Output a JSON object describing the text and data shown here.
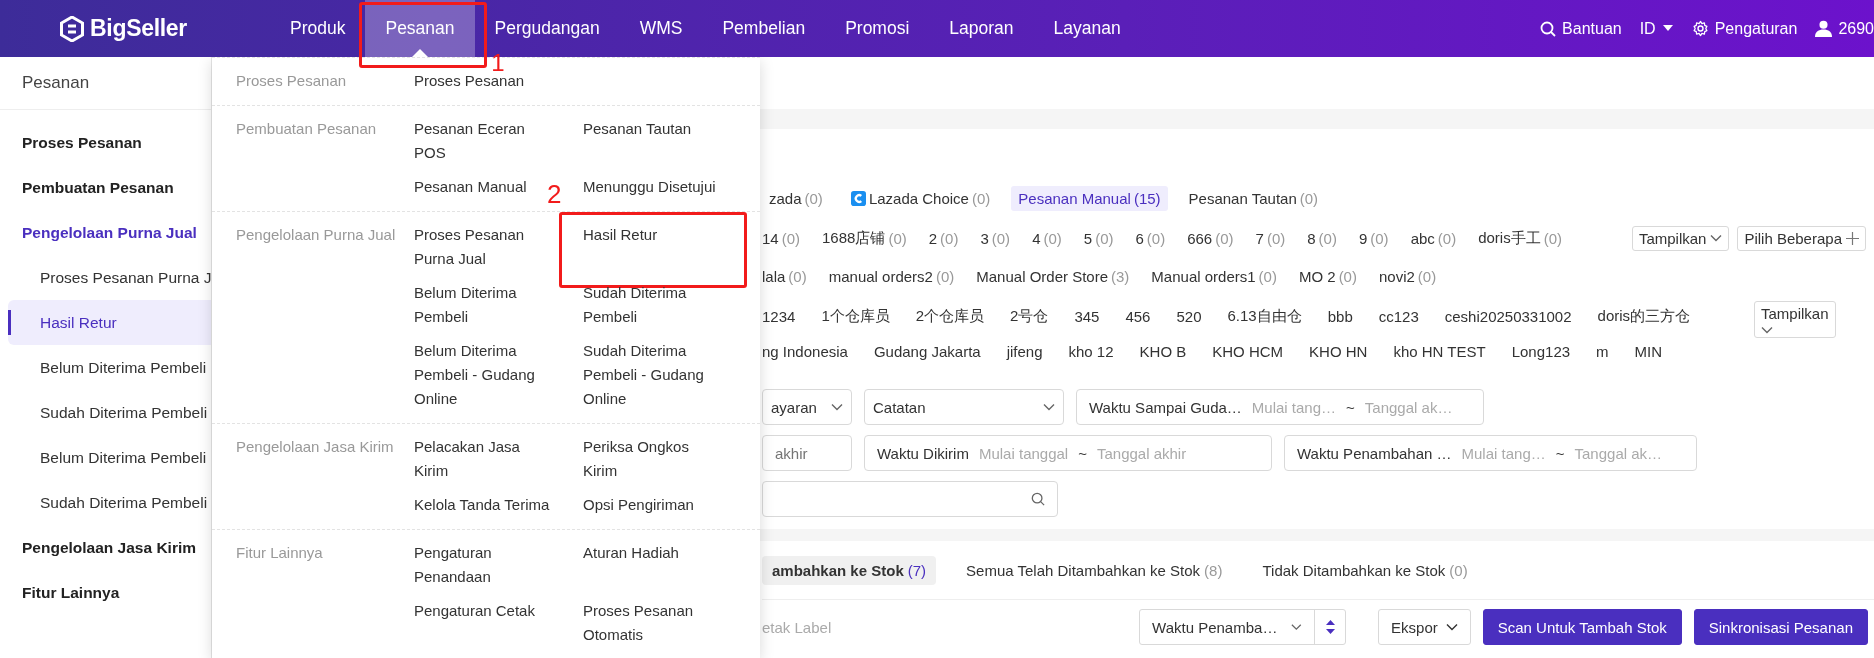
{
  "topbar": {
    "logo": "BigSeller",
    "nav": [
      {
        "label": "Produk",
        "selected": false
      },
      {
        "label": "Pesanan",
        "selected": true,
        "annotation": "1"
      },
      {
        "label": "Pergudangan",
        "selected": false
      },
      {
        "label": "WMS",
        "selected": false
      },
      {
        "label": "Pembelian",
        "selected": false
      },
      {
        "label": "Promosi",
        "selected": false
      },
      {
        "label": "Laporan",
        "selected": false
      },
      {
        "label": "Layanan",
        "selected": false
      }
    ],
    "help": "Bantuan",
    "language": "ID",
    "settings": "Pengaturan",
    "user": "2690"
  },
  "sidebar": {
    "title": "Pesanan",
    "items": [
      {
        "label": "Proses Pesanan",
        "selected": false
      },
      {
        "label": "Pembuatan Pesanan",
        "selected": false
      },
      {
        "label": "Pengelolaan Purna Jual",
        "selected": true,
        "children": [
          {
            "label": "Proses Pesanan Purna J",
            "selected": false
          },
          {
            "label": "Hasil Retur",
            "selected": true
          },
          {
            "label": "Belum Diterima Pembeli",
            "selected": false
          },
          {
            "label": "Sudah Diterima Pembeli",
            "selected": false
          },
          {
            "label": "Belum Diterima Pembeli",
            "selected": false
          },
          {
            "label": "Sudah Diterima Pembeli",
            "selected": false
          }
        ]
      },
      {
        "label": "Pengelolaan Jasa Kirim",
        "selected": false
      },
      {
        "label": "Fitur Lainnya",
        "selected": false
      }
    ]
  },
  "menu": {
    "sections": [
      {
        "title": "Proses Pesanan",
        "links": [
          {
            "label": "Proses Pesanan"
          }
        ]
      },
      {
        "title": "Pembuatan Pesanan",
        "links": [
          {
            "label": "Pesanan Eceran POS"
          },
          {
            "label": "Pesanan Tautan"
          },
          {
            "label": "Pesanan Manual"
          },
          {
            "label": "Menunggu Disetujui"
          }
        ]
      },
      {
        "title": "Pengelolaan Purna Jual",
        "links": [
          {
            "label": "Proses Pesanan Purna Jual"
          },
          {
            "label": "Hasil Retur",
            "annotation": "2"
          },
          {
            "label": "Belum Diterima Pembeli"
          },
          {
            "label": "Sudah Diterima Pembeli"
          },
          {
            "label": "Belum Diterima Pembeli - Gudang Online"
          },
          {
            "label": "Sudah Diterima Pembeli - Gudang Online"
          }
        ]
      },
      {
        "title": "Pengelolaan Jasa Kirim",
        "links": [
          {
            "label": "Pelacakan Jasa Kirim"
          },
          {
            "label": "Periksa Ongkos Kirim"
          },
          {
            "label": "Kelola Tanda Terima"
          },
          {
            "label": "Opsi Pengiriman"
          }
        ]
      },
      {
        "title": "Fitur Lainnya",
        "links": [
          {
            "label": "Pengaturan Penandaan"
          },
          {
            "label": "Aturan Hadiah"
          },
          {
            "label": "Pengaturan Cetak"
          },
          {
            "label": "Proses Pesanan Otomatis"
          }
        ]
      }
    ]
  },
  "filters": {
    "platforms": [
      {
        "label": "zada",
        "count": "(0)",
        "selected": false,
        "icon": false
      },
      {
        "label": "Lazada Choice",
        "count": "(0)",
        "selected": false,
        "icon": true
      },
      {
        "label": "Pesanan Manual",
        "count": "(15)",
        "selected": true,
        "icon": false
      },
      {
        "label": "Pesanan Tautan",
        "count": "(0)",
        "selected": false,
        "icon": false
      }
    ],
    "store_rows": [
      [
        {
          "label": "14",
          "count": "(0)"
        },
        {
          "label": "1688店铺",
          "count": "(0)"
        },
        {
          "label": "2",
          "count": "(0)"
        },
        {
          "label": "3",
          "count": "(0)"
        },
        {
          "label": "4",
          "count": "(0)"
        },
        {
          "label": "5",
          "count": "(0)"
        },
        {
          "label": "6",
          "count": "(0)"
        },
        {
          "label": "666",
          "count": "(0)"
        },
        {
          "label": "7",
          "count": "(0)"
        },
        {
          "label": "8",
          "count": "(0)"
        },
        {
          "label": "9",
          "count": "(0)"
        },
        {
          "label": "abc",
          "count": "(0)"
        },
        {
          "label": "doris手工",
          "count": "(0)"
        }
      ],
      [
        {
          "label": "lala",
          "count": "(0)"
        },
        {
          "label": "manual orders2",
          "count": "(0)"
        },
        {
          "label": "Manual Order Store",
          "count": "(3)"
        },
        {
          "label": "Manual orders1",
          "count": "(0)"
        },
        {
          "label": "MO 2",
          "count": "(0)"
        },
        {
          "label": "novi2",
          "count": "(0)"
        }
      ]
    ],
    "store_show": "Tampilkan",
    "store_multi": "Pilih Beberapa",
    "warehouse_rows": [
      [
        "1234",
        "1个仓库员",
        "2个仓库员",
        "2号仓",
        "345",
        "456",
        "520",
        "6.13自由仓",
        "bbb",
        "cc123",
        "ceshi20250331002",
        "doris的三方仓"
      ],
      [
        "ng Indonesia",
        "Gudang Jakarta",
        "jifeng",
        "kho 12",
        "KHO B",
        "KHO HCM",
        "KHO HN",
        "kho HN TEST",
        "Long123",
        "m",
        "MIN"
      ]
    ],
    "warehouse_show": "Tampilkan",
    "fields": [
      [
        {
          "kind": "select",
          "value": "ayaran"
        },
        {
          "kind": "select",
          "value": "Catatan"
        },
        {
          "kind": "date_range",
          "label": "Waktu Sampai Guda…",
          "start": "Mulai tang…",
          "separator": "~",
          "end": "Tanggal ak…"
        }
      ],
      [
        {
          "kind": "text",
          "placeholder": "akhir"
        },
        {
          "kind": "date_range",
          "label": "Waktu Dikirim",
          "start": "Mulai tanggal",
          "separator": "~",
          "end": "Tanggal akhir"
        },
        {
          "kind": "date_range",
          "label": "Waktu Penambahan …",
          "start": "Mulai tang…",
          "separator": "~",
          "end": "Tanggal ak…"
        }
      ],
      [
        {
          "kind": "search"
        }
      ]
    ]
  },
  "stock": {
    "tabs": [
      {
        "label": "ambahkan ke Stok",
        "count": "(7)",
        "selected": true
      },
      {
        "label": "Semua Telah Ditambahkan ke Stok",
        "count": "(8)",
        "selected": false
      },
      {
        "label": "Tidak Ditambahkan ke Stok",
        "count": "(0)",
        "selected": false
      }
    ],
    "print_label": "etak Label",
    "sort": "Waktu Penamba…",
    "export": "Ekspor",
    "buttons": [
      "Scan Untuk Tambah Stok",
      "Sinkronisasi Pesanan"
    ]
  }
}
